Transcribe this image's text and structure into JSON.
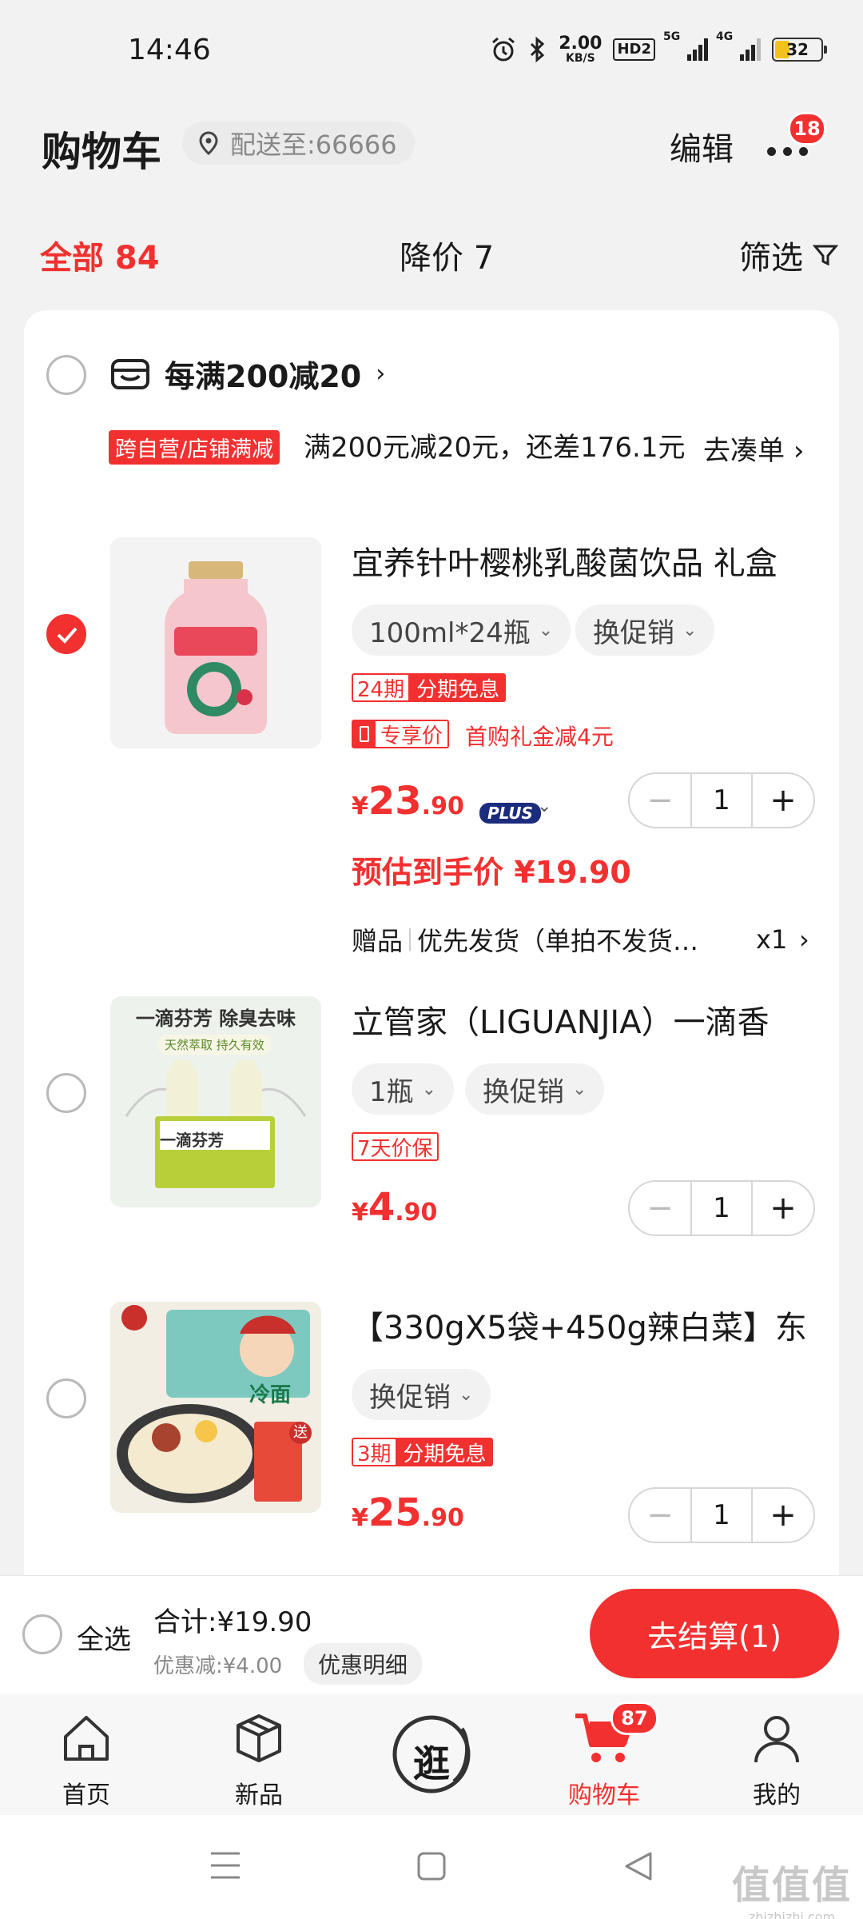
{
  "status_bar": {
    "time": "14:46",
    "net_speed_value": "2.00",
    "net_speed_unit": "KB/S",
    "hd_label": "HD2",
    "sig1_label": "5G",
    "sig2_label": "4G",
    "battery_level": "32"
  },
  "header": {
    "title": "购物车",
    "address": "配送至:66666",
    "edit_label": "编辑",
    "more_badge": "18"
  },
  "tabs": {
    "all": "全部 84",
    "price_drop": "降价 7",
    "filter": "筛选"
  },
  "promo": {
    "title": "每满200减20",
    "tag": "跨自营/店铺满减",
    "desc": "满200元减20元，还差176.1元",
    "go_label": "去凑单"
  },
  "items": [
    {
      "title": "宜养针叶樱桃乳酸菌饮品 礼盒",
      "spec": "100ml*24瓶",
      "promo_chip": "换促销",
      "installment_a": "24期",
      "installment_b": "分期免息",
      "exclusive_tag": "专享价",
      "coupon_text": "首购礼金减4元",
      "price_currency": "¥",
      "price_int": "23",
      "price_dec": ".90",
      "plus_label": "PLUS",
      "estimate": "预估到手价 ¥19.90",
      "gift_label": "赠品",
      "gift_text": "优先发货（单拍不发货…",
      "gift_qty": "x1",
      "qty": "1",
      "checked": true,
      "image_banner": "",
      "image_text": ""
    },
    {
      "title": "立管家（LIGUANJIA）一滴香",
      "spec": "1瓶",
      "promo_chip": "换促销",
      "guarantee_tag": "7天价保",
      "price_currency": "¥",
      "price_int": "4",
      "price_dec": ".90",
      "qty": "1",
      "checked": false,
      "image_banner": "一滴芬芳 除臭去味",
      "image_sub": "天然萃取  持久有效",
      "image_text": "一滴芬芳"
    },
    {
      "title": "【330gX5袋+450g辣白菜】东",
      "promo_chip": "换促销",
      "installment_a": "3期",
      "installment_b": "分期免息",
      "price_currency": "¥",
      "price_int": "25",
      "price_dec": ".90",
      "qty": "1",
      "checked": false,
      "image_text": "冷面",
      "image_gift": "送"
    }
  ],
  "checkout": {
    "select_all": "全选",
    "total": "合计:¥19.90",
    "discount": "优惠减:¥4.00",
    "detail_label": "优惠明细",
    "button": "去结算(1)"
  },
  "tabbar": {
    "home": "首页",
    "new": "新品",
    "browse": "逛",
    "cart": "购物车",
    "cart_badge": "87",
    "me": "我的"
  },
  "watermark": {
    "big": "值值值",
    "small": "zhizhizhi.com"
  },
  "colors": {
    "accent": "#f23030",
    "background": "#f2f2f2",
    "card": "#ffffff",
    "battery": "#f3c21a"
  }
}
